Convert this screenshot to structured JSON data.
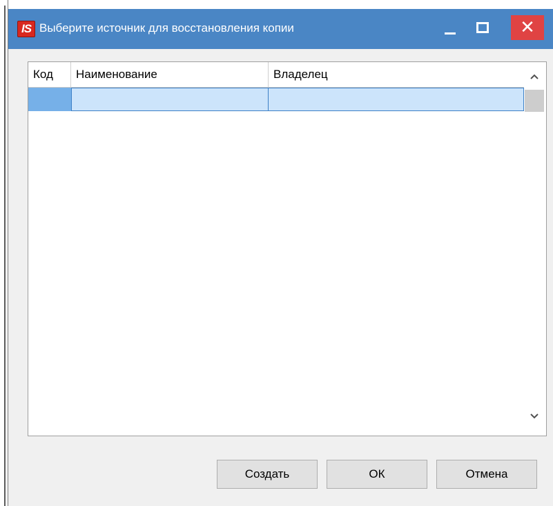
{
  "window": {
    "title": "Выберите источник для восстановления копии",
    "logo_text": "IS",
    "close_glyph": "✕",
    "accent_color": "#4a86c5",
    "close_color": "#e04343"
  },
  "table": {
    "columns": [
      "Код",
      "Наименование",
      "Владелец"
    ],
    "rows": [
      {
        "code": "",
        "name": "",
        "owner": ""
      }
    ],
    "selected_row": 0
  },
  "buttons": {
    "create": "Создать",
    "ok": "ОК",
    "cancel": "Отмена"
  },
  "icons": {
    "app": "is-logo-icon",
    "minimize": "minimize-icon",
    "maximize": "maximize-icon",
    "close": "close-icon",
    "scroll_up": "chevron-up-icon",
    "scroll_down": "chevron-down-icon"
  }
}
